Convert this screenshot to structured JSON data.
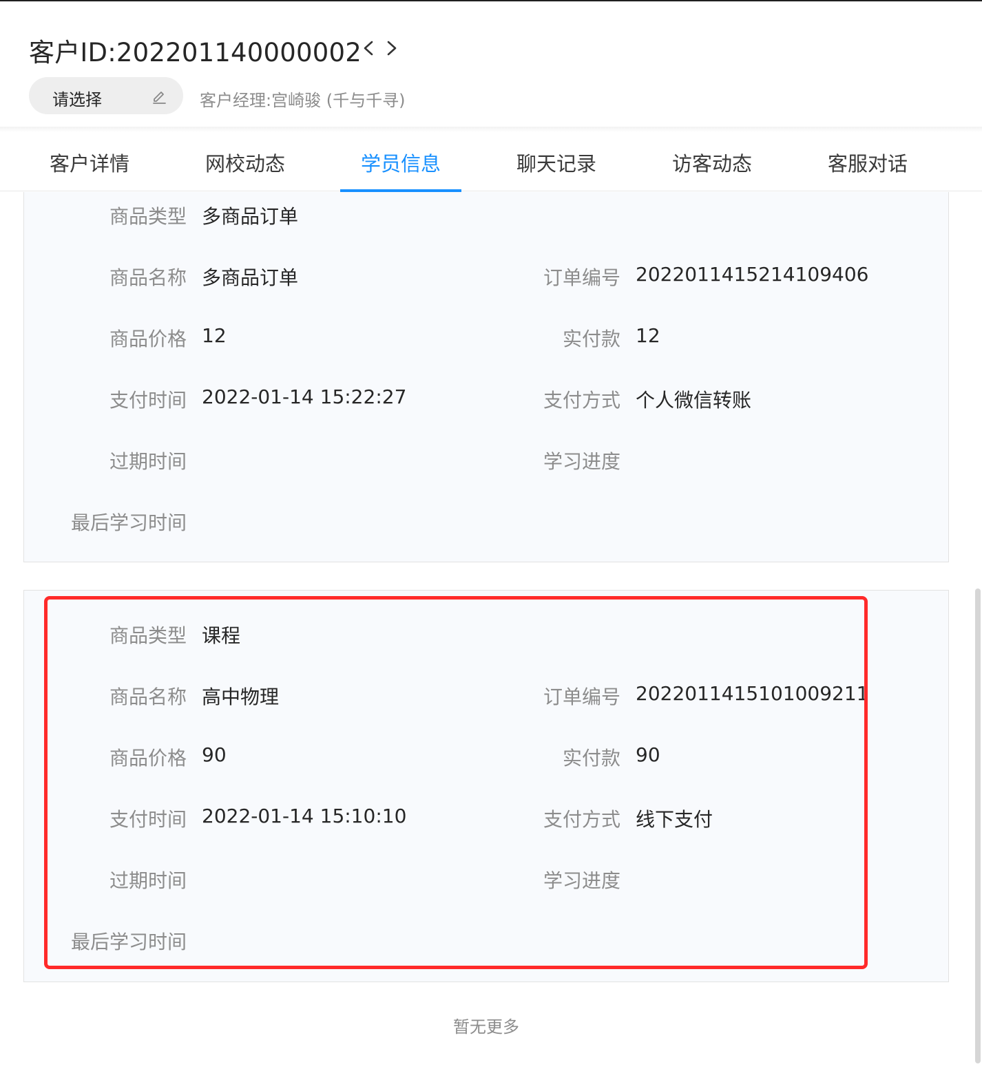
{
  "header": {
    "customer_id": "客户ID:202201140000002",
    "select_label": "请选择",
    "manager": "客户经理:宫崎骏 (千与千寻)"
  },
  "tabs": [
    {
      "label": "客户详情",
      "active": false
    },
    {
      "label": "网校动态",
      "active": false
    },
    {
      "label": "学员信息",
      "active": true
    },
    {
      "label": "聊天记录",
      "active": false
    },
    {
      "label": "访客动态",
      "active": false
    },
    {
      "label": "客服对话",
      "active": false
    }
  ],
  "orders": [
    {
      "product_type_label": "商品类型",
      "product_type": "多商品订单",
      "product_name_label": "商品名称",
      "product_name": "多商品订单",
      "order_no_label": "订单编号",
      "order_no": "2022011415214109406",
      "price_label": "商品价格",
      "price": "12",
      "paid_label": "实付款",
      "paid": "12",
      "pay_time_label": "支付时间",
      "pay_time": "2022-01-14 15:22:27",
      "pay_method_label": "支付方式",
      "pay_method": "个人微信转账",
      "expire_label": "过期时间",
      "expire": "",
      "progress_label": "学习进度",
      "progress": "",
      "last_study_label": "最后学习时间",
      "last_study": ""
    },
    {
      "product_type_label": "商品类型",
      "product_type": "课程",
      "product_name_label": "商品名称",
      "product_name": "高中物理",
      "order_no_label": "订单编号",
      "order_no": "2022011415101009211",
      "price_label": "商品价格",
      "price": "90",
      "paid_label": "实付款",
      "paid": "90",
      "pay_time_label": "支付时间",
      "pay_time": "2022-01-14 15:10:10",
      "pay_method_label": "支付方式",
      "pay_method": "线下支付",
      "expire_label": "过期时间",
      "expire": "",
      "progress_label": "学习进度",
      "progress": "",
      "last_study_label": "最后学习时间",
      "last_study": ""
    }
  ],
  "footer": {
    "no_more": "暂无更多"
  },
  "colors": {
    "accent": "#1890ff",
    "highlight": "#ff2a2a"
  },
  "icons": [
    "chevron-left-icon",
    "chevron-right-icon",
    "edit-pencil-icon"
  ]
}
